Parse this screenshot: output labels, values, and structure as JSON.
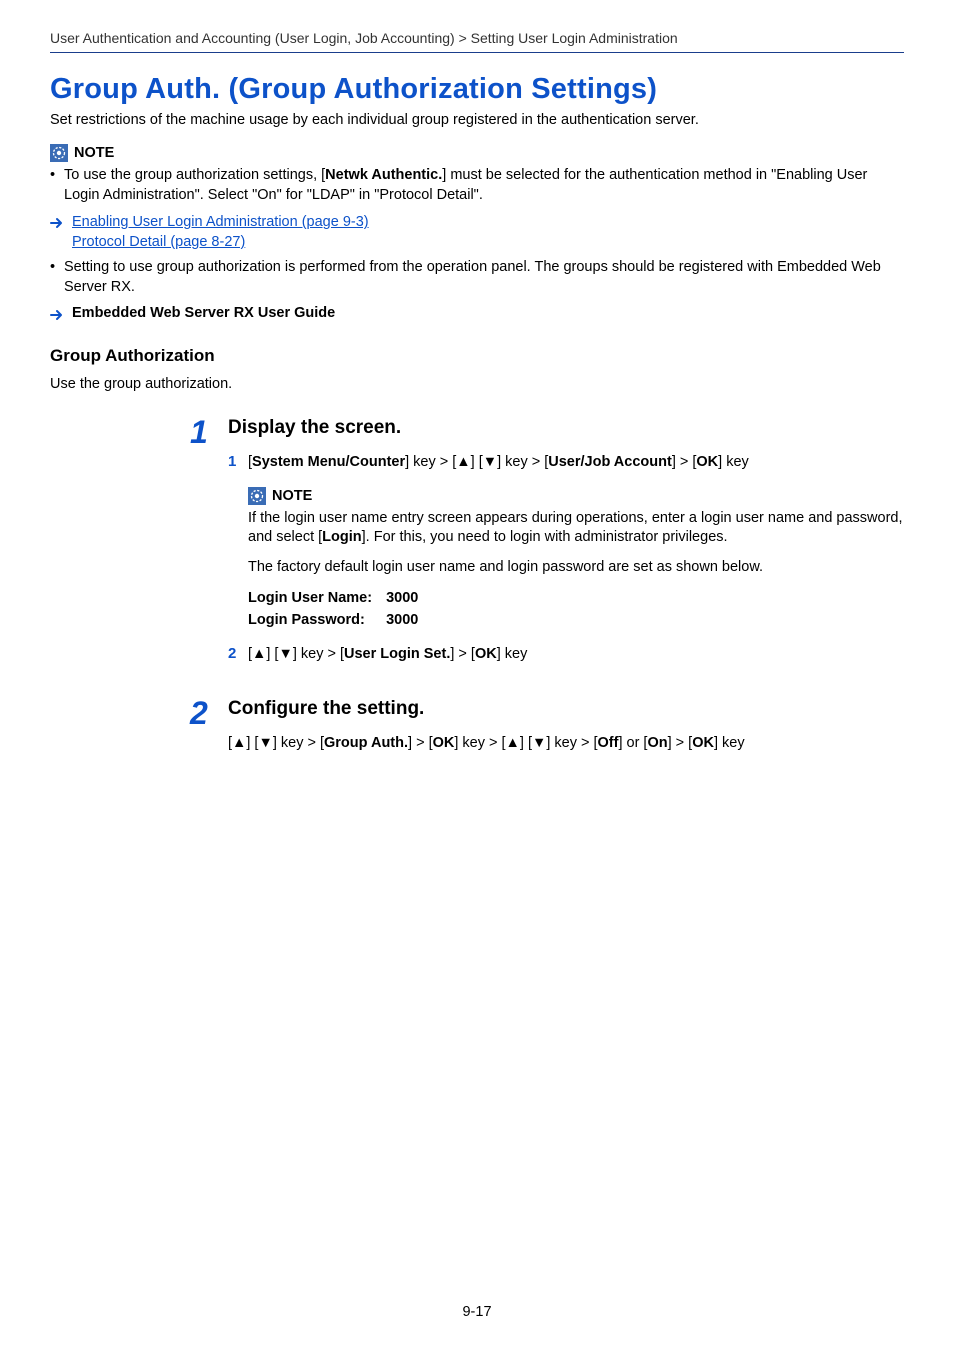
{
  "breadcrumb": "User Authentication and Accounting (User Login, Job Accounting) > Setting User Login Administration",
  "title": "Group Auth. (Group Authorization Settings)",
  "intro": "Set restrictions of the machine usage by each individual group registered in the authentication server.",
  "note_label": "NOTE",
  "note_bullet_1a": "To use the group authorization settings, [",
  "note_bullet_1b": "Netwk Authentic.",
  "note_bullet_1c": "] must be selected for the authentication method in \"Enabling User Login Administration\". Select \"On\" for \"LDAP\" in \"Protocol Detail\".",
  "link1": "Enabling User Login Administration (page 9-3)",
  "link2": "Protocol Detail (page 8-27)",
  "note_bullet_2": "Setting to use group authorization is performed from the operation panel. The groups should be registered with Embedded Web Server RX.",
  "ref_guide": "Embedded Web Server RX User Guide",
  "subheading": "Group Authorization",
  "subintro": "Use the group authorization.",
  "step1_num": "1",
  "step1_head": "Display the screen.",
  "step1_sub1_num": "1",
  "s1s1_p1": "[",
  "s1s1_p2": "System Menu/Counter",
  "s1s1_p3": "] key > [▲] [▼] key > [",
  "s1s1_p4": "User/Job Account",
  "s1s1_p5": "] > [",
  "s1s1_p6": "OK",
  "s1s1_p7": "] key",
  "inner_note_t1": "If the login user name entry screen appears during operations, enter a login user name and password, and select [",
  "inner_note_t2": "Login",
  "inner_note_t3": "]. For this, you need to login with administrator privileges.",
  "inner_note_t4": "The factory default login user name and login password are set as shown below.",
  "login_user_label": "Login User Name:",
  "login_user_value": "3000",
  "login_pass_label": "Login Password:",
  "login_pass_value": "3000",
  "step1_sub2_num": "2",
  "s1s2_p1": "[▲] [▼] key > [",
  "s1s2_p2": "User Login Set.",
  "s1s2_p3": "] > [",
  "s1s2_p4": "OK",
  "s1s2_p5": "] key",
  "step2_num": "2",
  "step2_head": "Configure the setting.",
  "s2_p1": "[▲] [▼] key > [",
  "s2_p2": "Group Auth.",
  "s2_p3": "] > [",
  "s2_p4": "OK",
  "s2_p5": "] key > [▲] [▼] key > [",
  "s2_p6": "Off",
  "s2_p7": "] or [",
  "s2_p8": "On",
  "s2_p9": "] > [",
  "s2_p10": "OK",
  "s2_p11": "] key",
  "page_number": "9-17"
}
